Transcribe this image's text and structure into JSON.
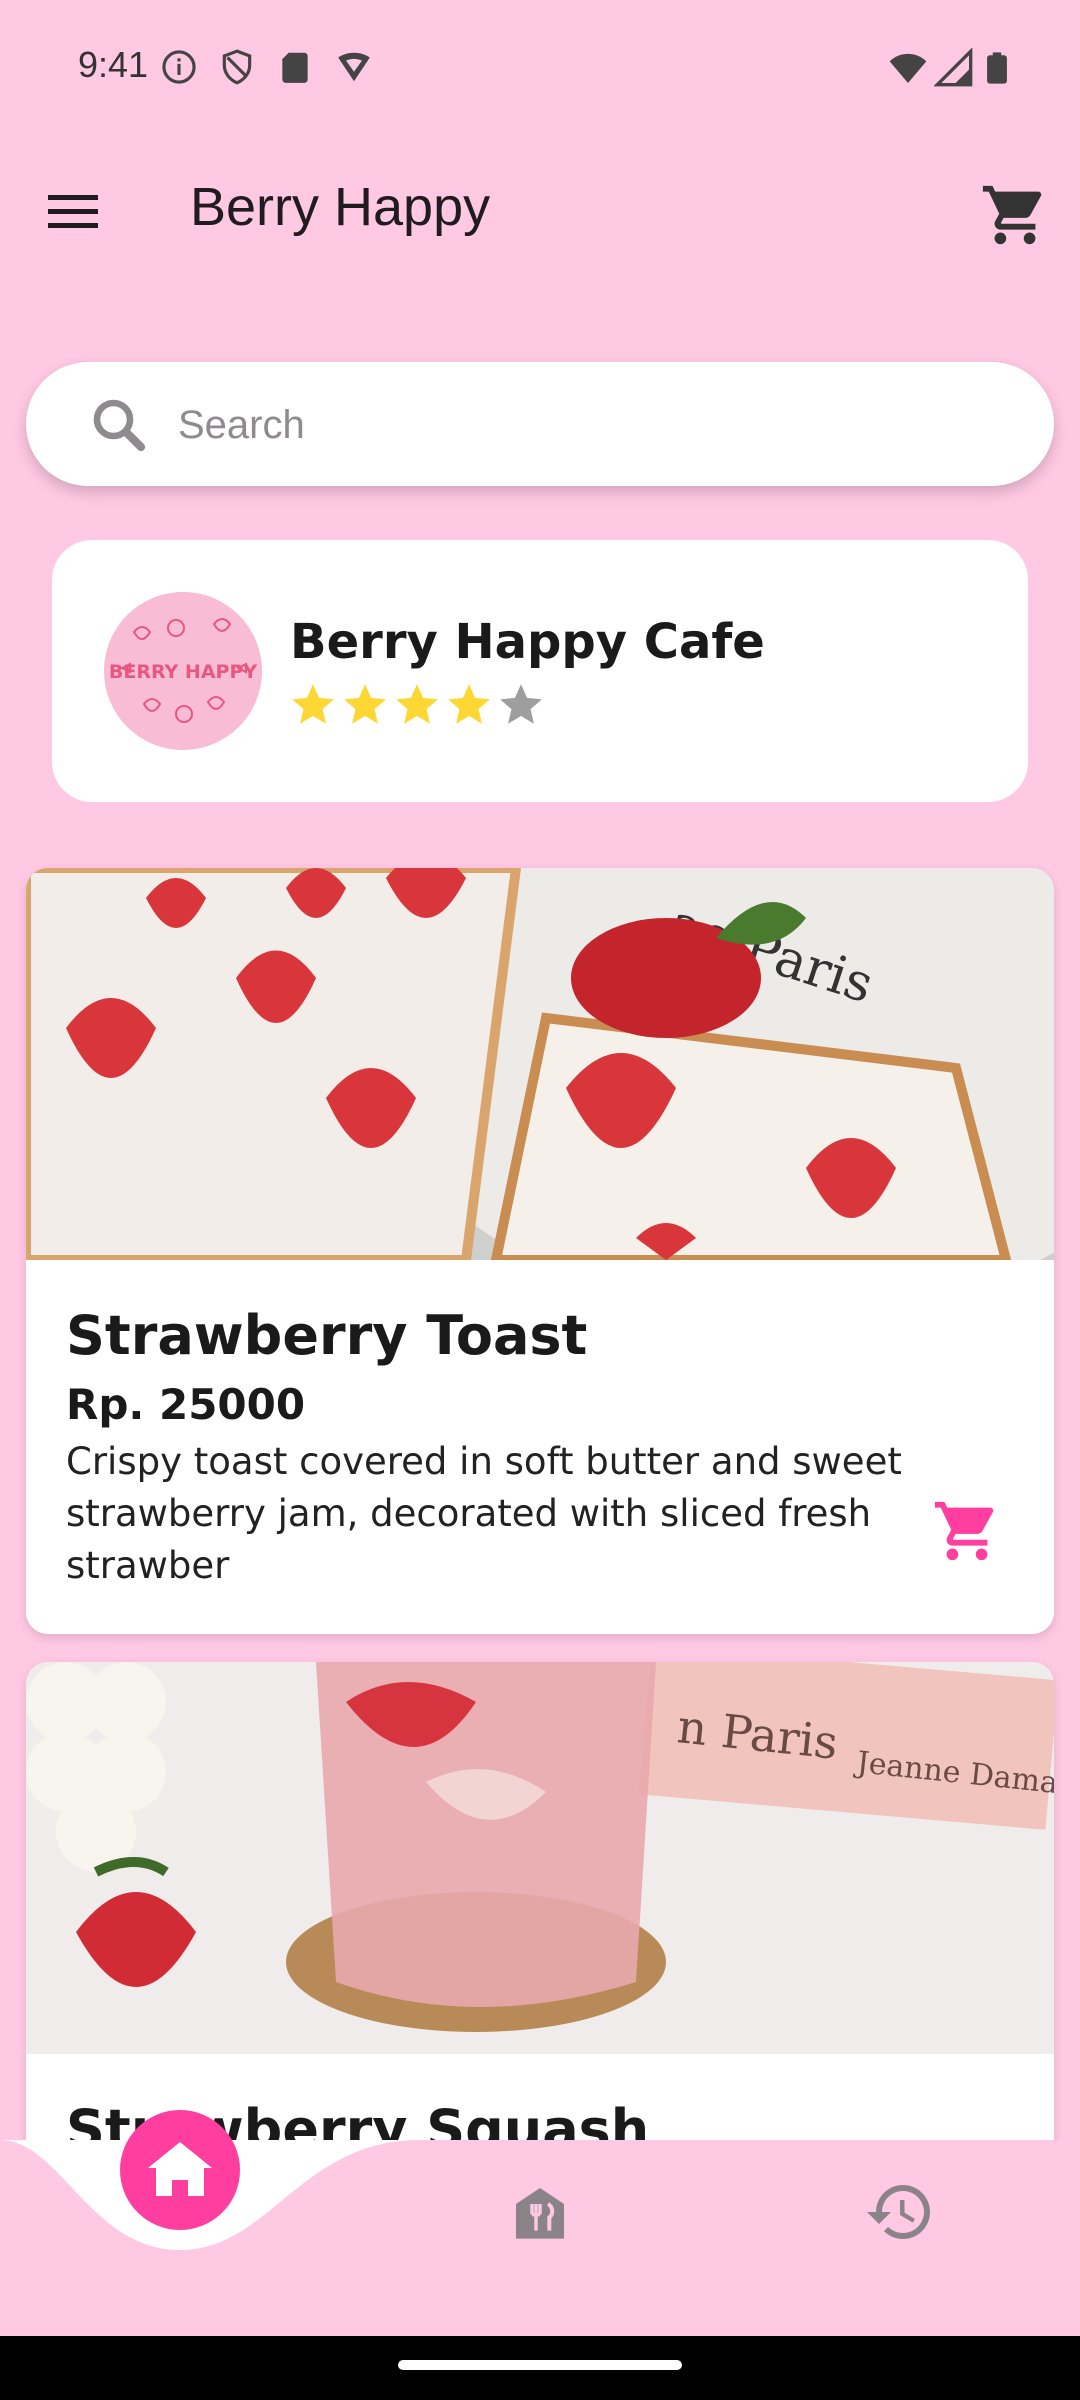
{
  "status_bar": {
    "time": "9:41"
  },
  "app_bar": {
    "title": "Berry Happy"
  },
  "search": {
    "placeholder": "Search",
    "value": ""
  },
  "cafe": {
    "name": "Berry Happy Cafe",
    "logo_text": "BERRY HAPPY",
    "rating": 4,
    "max_rating": 5
  },
  "products": [
    {
      "name": "Strawberry Toast",
      "price": "Rp. 25000",
      "description": "Crispy toast covered in soft butter and sweet strawberry jam, decorated with sliced fresh strawber"
    },
    {
      "name": "Strawberry Squash",
      "price": "",
      "description": ""
    }
  ],
  "colors": {
    "background": "#ffc8e3",
    "accent": "#ff3ea0",
    "star_filled": "#fdd835",
    "star_empty": "#9e9e9e"
  },
  "icons": {
    "menu": "menu-icon",
    "cart": "cart-icon",
    "search": "search-icon",
    "home": "home-icon",
    "restaurant": "restaurant-menu-icon",
    "history": "history-icon"
  }
}
